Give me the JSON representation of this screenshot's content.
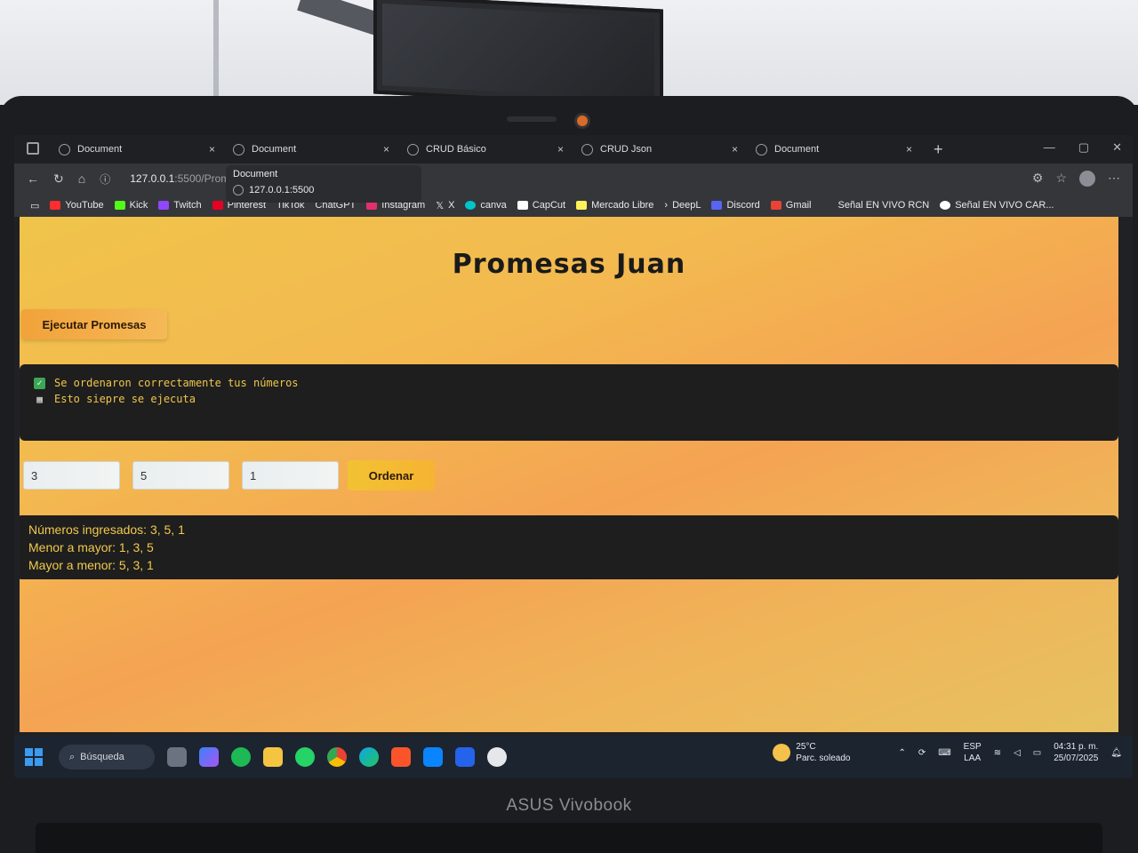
{
  "browser": {
    "tabs": [
      {
        "label": "Document",
        "active": false
      },
      {
        "label": "Document",
        "active": true
      },
      {
        "label": "CRUD Básico",
        "active": false
      },
      {
        "label": "CRUD Json",
        "active": false
      },
      {
        "label": "Document",
        "active": false
      }
    ],
    "tab_close": "×",
    "new_tab": "+",
    "url_host": "127.0.0.1",
    "url_rest": ":5500/Prom",
    "hover_card": {
      "title": "Document",
      "url": "127.0.0.1:5500"
    },
    "bookmarks": [
      {
        "label": "YouTube",
        "color": "#ff2d2d"
      },
      {
        "label": "Kick",
        "color": "#53fc18"
      },
      {
        "label": "Twitch",
        "color": "#9146ff"
      },
      {
        "label": "Pinterest",
        "color": "#e60023"
      },
      {
        "label": "TikTok",
        "color": "#ffffff"
      },
      {
        "label": "ChatGPT",
        "color": "#cccccc"
      },
      {
        "label": "Instagram",
        "color": "#e1306c"
      },
      {
        "label": "X",
        "color": "#ffffff"
      },
      {
        "label": "canva",
        "color": "#00c4cc"
      },
      {
        "label": "CapCut",
        "color": "#ffffff"
      },
      {
        "label": "Mercado Libre",
        "color": "#fff159"
      },
      {
        "label": "DeepL",
        "color": "#ffffff"
      },
      {
        "label": "Discord",
        "color": "#5865f2"
      },
      {
        "label": "Gmail",
        "color": "#ea4335"
      },
      {
        "label": "Señal EN VIVO RCN",
        "color": "#35363a"
      },
      {
        "label": "Señal EN VIVO CAR...",
        "color": "#ffffff"
      }
    ]
  },
  "page": {
    "title": "Promesas Juan",
    "exec_button": "Ejecutar Promesas",
    "console": {
      "line1": "Se ordenaron correctamente tus números",
      "line2": "Esto siepre se ejecuta"
    },
    "inputs": [
      "3",
      "5",
      "1"
    ],
    "sort_button": "Ordenar",
    "results": {
      "entered": "Números ingresados: 3, 5, 1",
      "ascending": "Menor a mayor: 1, 3, 5",
      "descending": "Mayor a menor: 5, 3, 1"
    }
  },
  "taskbar": {
    "search": "Búsqueda",
    "weather_temp": "25°C",
    "weather_desc": "Parc. soleado",
    "lang1": "ESP",
    "lang2": "LAA",
    "time": "04:31 p. m.",
    "date": "25/07/2025"
  },
  "laptop_brand": "ASUS Vivobook"
}
